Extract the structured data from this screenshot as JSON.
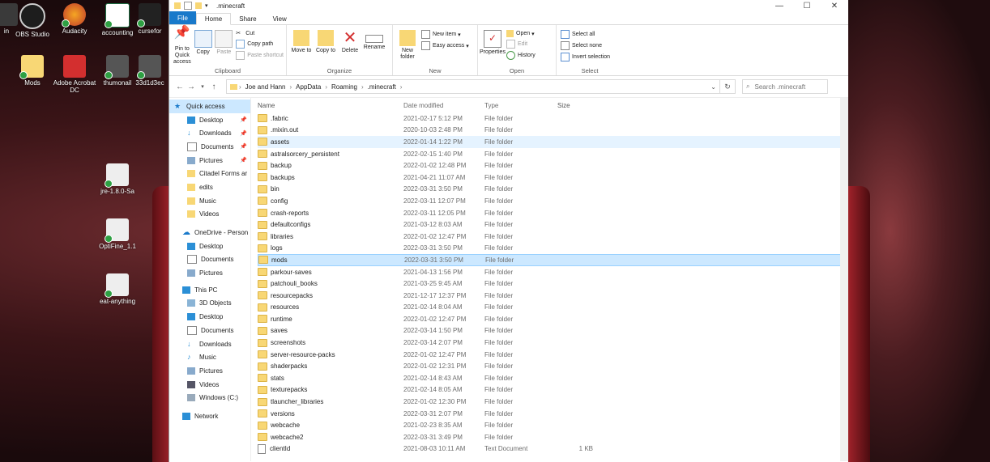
{
  "desktop": {
    "icons": [
      {
        "label": "in"
      },
      {
        "label": "OBS Studio"
      },
      {
        "label": "Audacity"
      },
      {
        "label": "accounting"
      },
      {
        "label": "cursefor"
      },
      {
        "label": "Mods"
      },
      {
        "label": "Adobe Acrobat DC"
      },
      {
        "label": "thumonail"
      },
      {
        "label": "33d1d3ec"
      },
      {
        "label": "jre-1.8.0-Sa"
      },
      {
        "label": "OptiFine_1.1"
      },
      {
        "label": "eat-anything"
      }
    ]
  },
  "window": {
    "title": ".minecraft",
    "controls": {
      "minimize": "—",
      "maximize": "☐",
      "close": "✕"
    },
    "tabs": [
      "File",
      "Home",
      "Share",
      "View"
    ],
    "ribbon": {
      "clipboard": {
        "label": "Clipboard",
        "pin": "Pin to Quick access",
        "copy": "Copy",
        "paste": "Paste",
        "cut": "Cut",
        "copy_path": "Copy path",
        "paste_shortcut": "Paste shortcut"
      },
      "organize": {
        "label": "Organize",
        "move_to": "Move to",
        "copy_to": "Copy to",
        "delete": "Delete",
        "rename": "Rename"
      },
      "new": {
        "label": "New",
        "new_folder": "New folder",
        "new_item": "New item",
        "easy_access": "Easy access"
      },
      "open": {
        "label": "Open",
        "properties": "Properties",
        "open": "Open",
        "edit": "Edit",
        "history": "History"
      },
      "select": {
        "label": "Select",
        "select_all": "Select all",
        "select_none": "Select none",
        "invert": "Invert selection"
      }
    },
    "address": {
      "path": [
        "Joe and Hann",
        "AppData",
        "Roaming",
        ".minecraft"
      ],
      "search_placeholder": "Search .minecraft"
    },
    "nav": {
      "quick_access": "Quick access",
      "quick_items": [
        "Desktop",
        "Downloads",
        "Documents",
        "Pictures",
        "Citadel Forms ar",
        "edits",
        "Music",
        "Videos"
      ],
      "onedrive": "OneDrive - Person",
      "onedrive_items": [
        "Desktop",
        "Documents",
        "Pictures"
      ],
      "this_pc": "This PC",
      "pc_items": [
        "3D Objects",
        "Desktop",
        "Documents",
        "Downloads",
        "Music",
        "Pictures",
        "Videos",
        "Windows (C:)"
      ],
      "network": "Network"
    },
    "columns": {
      "name": "Name",
      "date": "Date modified",
      "type": "Type",
      "size": "Size"
    },
    "files": [
      {
        "name": ".fabric",
        "date": "2021-02-17 5:12 PM",
        "type": "File folder",
        "size": ""
      },
      {
        "name": ".mixin.out",
        "date": "2020-10-03 2:48 PM",
        "type": "File folder",
        "size": ""
      },
      {
        "name": "assets",
        "date": "2022-01-14 1:22 PM",
        "type": "File folder",
        "size": ""
      },
      {
        "name": "astralsorcery_persistent",
        "date": "2022-02-15 1:40 PM",
        "type": "File folder",
        "size": ""
      },
      {
        "name": "backup",
        "date": "2022-01-02 12:48 PM",
        "type": "File folder",
        "size": ""
      },
      {
        "name": "backups",
        "date": "2021-04-21 11:07 AM",
        "type": "File folder",
        "size": ""
      },
      {
        "name": "bin",
        "date": "2022-03-31 3:50 PM",
        "type": "File folder",
        "size": ""
      },
      {
        "name": "config",
        "date": "2022-03-11 12:07 PM",
        "type": "File folder",
        "size": ""
      },
      {
        "name": "crash-reports",
        "date": "2022-03-11 12:05 PM",
        "type": "File folder",
        "size": ""
      },
      {
        "name": "defaultconfigs",
        "date": "2021-03-12 8:03 AM",
        "type": "File folder",
        "size": ""
      },
      {
        "name": "libraries",
        "date": "2022-01-02 12:47 PM",
        "type": "File folder",
        "size": ""
      },
      {
        "name": "logs",
        "date": "2022-03-31 3:50 PM",
        "type": "File folder",
        "size": ""
      },
      {
        "name": "mods",
        "date": "2022-03-31 3:50 PM",
        "type": "File folder",
        "size": ""
      },
      {
        "name": "parkour-saves",
        "date": "2021-04-13 1:56 PM",
        "type": "File folder",
        "size": ""
      },
      {
        "name": "patchouli_books",
        "date": "2021-03-25 9:45 AM",
        "type": "File folder",
        "size": ""
      },
      {
        "name": "resourcepacks",
        "date": "2021-12-17 12:37 PM",
        "type": "File folder",
        "size": ""
      },
      {
        "name": "resources",
        "date": "2021-02-14 8:04 AM",
        "type": "File folder",
        "size": ""
      },
      {
        "name": "runtime",
        "date": "2022-01-02 12:47 PM",
        "type": "File folder",
        "size": ""
      },
      {
        "name": "saves",
        "date": "2022-03-14 1:50 PM",
        "type": "File folder",
        "size": ""
      },
      {
        "name": "screenshots",
        "date": "2022-03-14 2:07 PM",
        "type": "File folder",
        "size": ""
      },
      {
        "name": "server-resource-packs",
        "date": "2022-01-02 12:47 PM",
        "type": "File folder",
        "size": ""
      },
      {
        "name": "shaderpacks",
        "date": "2022-01-02 12:31 PM",
        "type": "File folder",
        "size": ""
      },
      {
        "name": "stats",
        "date": "2021-02-14 8:43 AM",
        "type": "File folder",
        "size": ""
      },
      {
        "name": "texturepacks",
        "date": "2021-02-14 8:05 AM",
        "type": "File folder",
        "size": ""
      },
      {
        "name": "tlauncher_libraries",
        "date": "2022-01-02 12:30 PM",
        "type": "File folder",
        "size": ""
      },
      {
        "name": "versions",
        "date": "2022-03-31 2:07 PM",
        "type": "File folder",
        "size": ""
      },
      {
        "name": "webcache",
        "date": "2021-02-23 8:35 AM",
        "type": "File folder",
        "size": ""
      },
      {
        "name": "webcache2",
        "date": "2022-03-31 3:49 PM",
        "type": "File folder",
        "size": ""
      },
      {
        "name": "clientId",
        "date": "2021-08-03 10:11 AM",
        "type": "Text Document",
        "size": "1 KB"
      }
    ],
    "colors": {
      "accent": "#1979ca",
      "selection": "#cce8ff",
      "folder": "#f8d775"
    }
  }
}
